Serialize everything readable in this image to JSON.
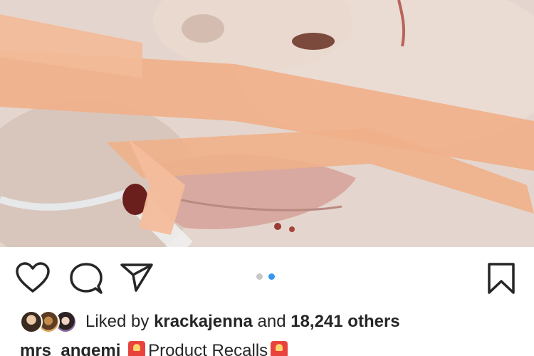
{
  "post": {
    "image_alt": "Close-up photo of a face with orange medical tape across the mouth and a tube",
    "pager": {
      "total": 2,
      "active_index": 1
    }
  },
  "actions": {
    "like_icon": "heart-outline-icon",
    "comment_icon": "comment-bubble-icon",
    "share_icon": "paper-plane-icon",
    "save_icon": "bookmark-outline-icon"
  },
  "likes": {
    "prefix": "Liked by",
    "user": "krackajenna",
    "middle": "and",
    "count": "18,241 others"
  },
  "caption": {
    "username": "mrs_angemi",
    "emoji_icon": "siren-emoji-icon",
    "text": "Product Recalls"
  },
  "colors": {
    "accent": "#3897f0",
    "tape": "#f0b08a",
    "text": "#262626"
  }
}
